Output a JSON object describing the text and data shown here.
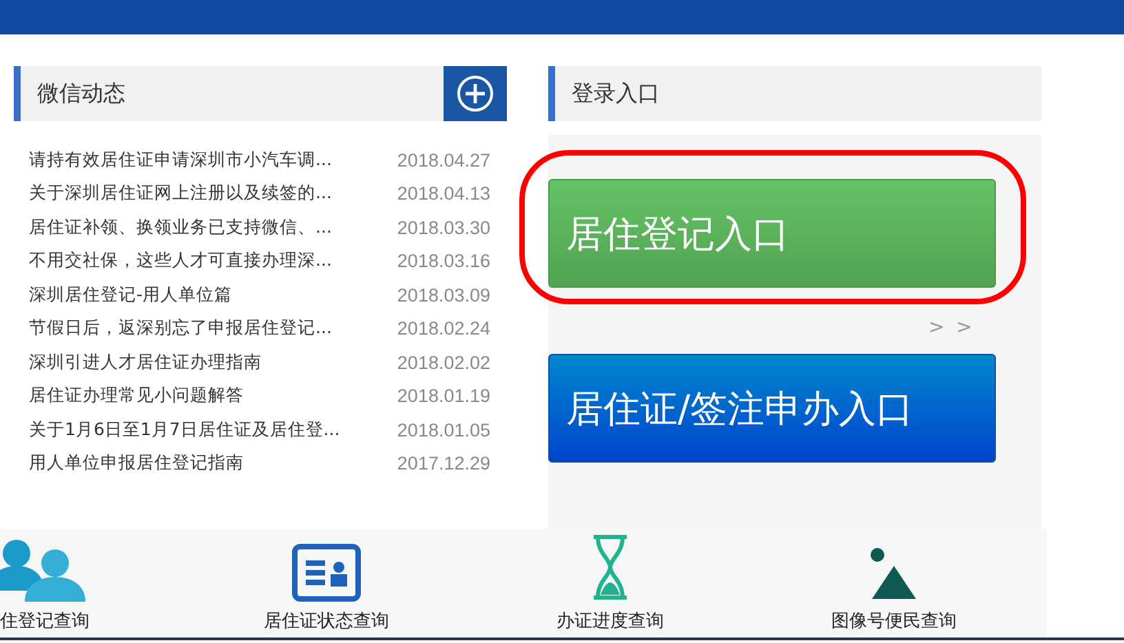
{
  "wechat_panel": {
    "title": "微信动态",
    "items": [
      {
        "title": "请持有效居住证申请深圳市小汽车调...",
        "date": "2018.04.27"
      },
      {
        "title": "关于深圳居住证网上注册以及续签的...",
        "date": "2018.04.13"
      },
      {
        "title": "居住证补领、换领业务已支持微信、...",
        "date": "2018.03.30"
      },
      {
        "title": "不用交社保，这些人才可直接办理深...",
        "date": "2018.03.16"
      },
      {
        "title": "深圳居住登记-用人单位篇",
        "date": "2018.03.09"
      },
      {
        "title": "节假日后，返深别忘了申报居住登记...",
        "date": "2018.02.24"
      },
      {
        "title": "深圳引进人才居住证办理指南",
        "date": "2018.02.02"
      },
      {
        "title": "居住证办理常见小问题解答",
        "date": "2018.01.19"
      },
      {
        "title": "关于1月6日至1月7日居住证及居住登...",
        "date": "2018.01.05"
      },
      {
        "title": "用人单位申报居住登记指南",
        "date": "2017.12.29"
      }
    ]
  },
  "login_panel": {
    "title": "登录入口",
    "entries": [
      {
        "label": "居住登记入口",
        "kind": "green",
        "more": "> >",
        "highlighted": true
      },
      {
        "label": "居住证/签注申办入口",
        "kind": "blue",
        "highlighted": false
      }
    ]
  },
  "query_bar": [
    {
      "label": "住登记查询",
      "kind": "people"
    },
    {
      "label": "居住证状态查询",
      "kind": "card"
    },
    {
      "label": "办证进度查询",
      "kind": "hourglass"
    },
    {
      "label": "图像号便民查询",
      "kind": "image"
    }
  ]
}
